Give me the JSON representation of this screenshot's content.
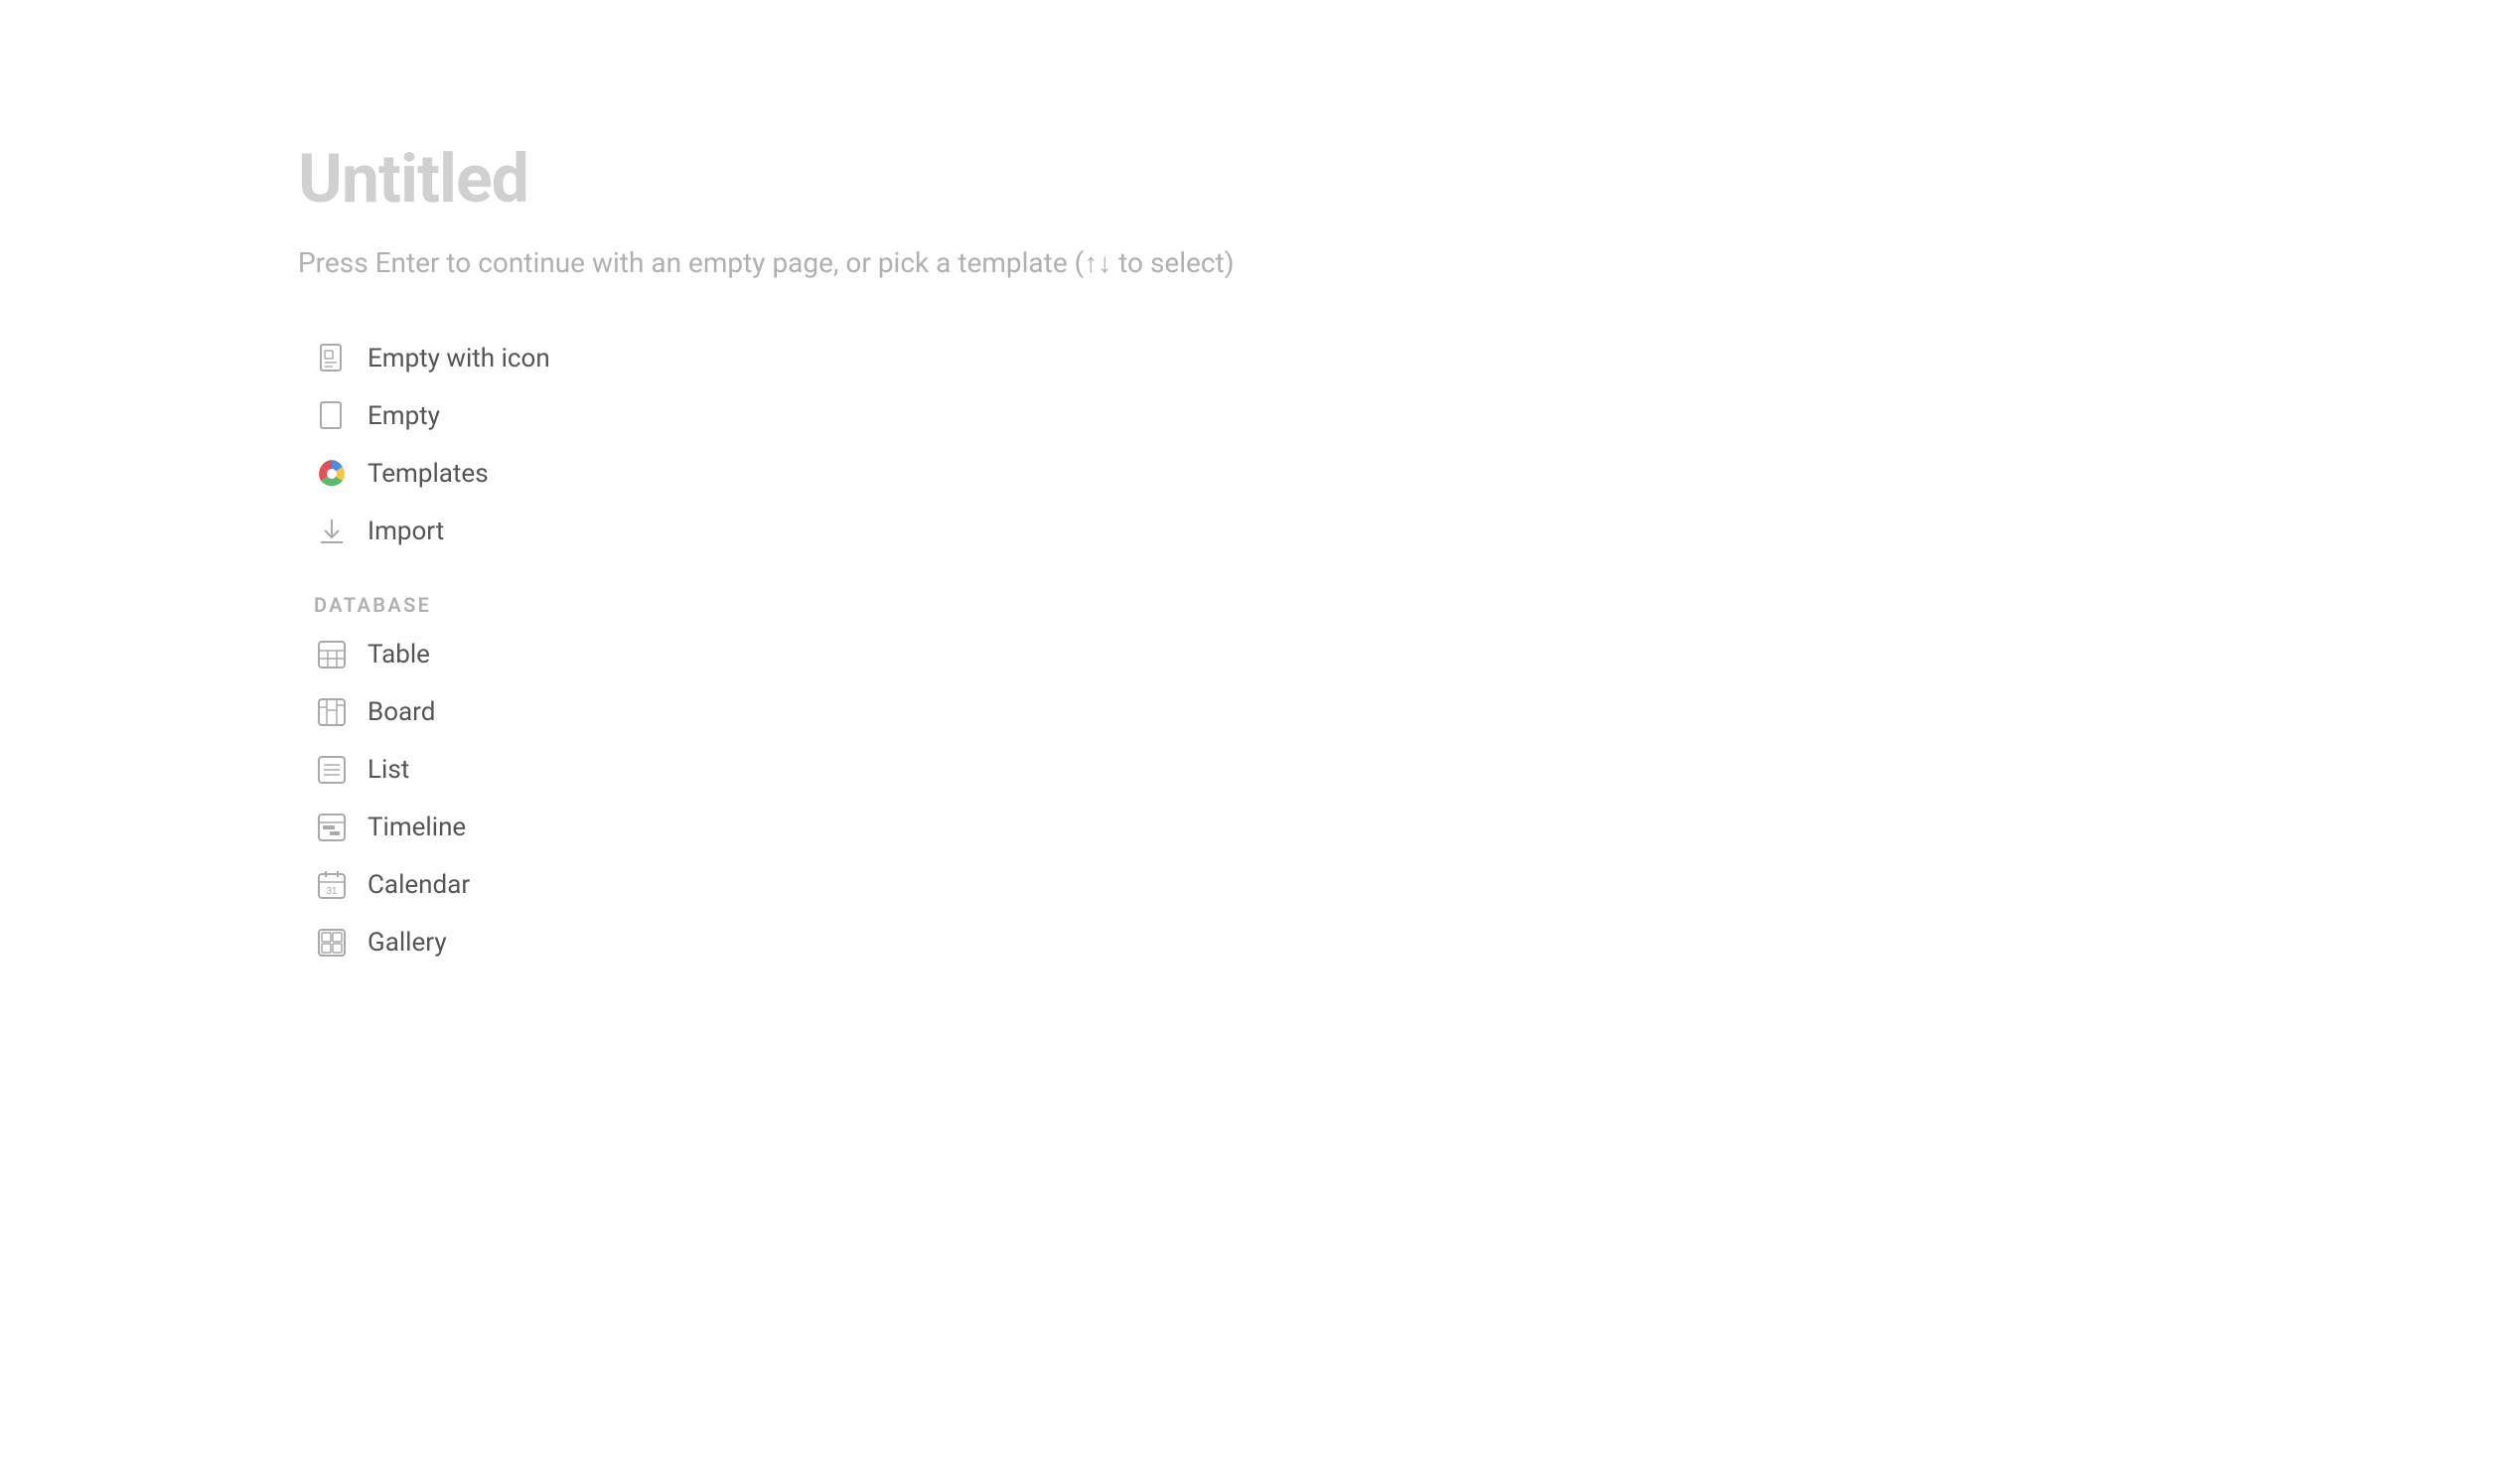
{
  "page": {
    "title": "Untitled",
    "subtitle": "Press Enter to continue with an empty page, or pick a template (↑↓ to select)"
  },
  "menu": {
    "items": [
      {
        "id": "empty-with-icon",
        "label": "Empty with icon",
        "icon": "document-icon"
      },
      {
        "id": "empty",
        "label": "Empty",
        "icon": "document-plain-icon"
      },
      {
        "id": "templates",
        "label": "Templates",
        "icon": "templates-icon"
      },
      {
        "id": "import",
        "label": "Import",
        "icon": "import-icon"
      }
    ],
    "database_label": "DATABASE",
    "database_items": [
      {
        "id": "table",
        "label": "Table",
        "icon": "table-icon"
      },
      {
        "id": "board",
        "label": "Board",
        "icon": "board-icon"
      },
      {
        "id": "list",
        "label": "List",
        "icon": "list-icon"
      },
      {
        "id": "timeline",
        "label": "Timeline",
        "icon": "timeline-icon"
      },
      {
        "id": "calendar",
        "label": "Calendar",
        "icon": "calendar-icon"
      },
      {
        "id": "gallery",
        "label": "Gallery",
        "icon": "gallery-icon"
      }
    ]
  }
}
